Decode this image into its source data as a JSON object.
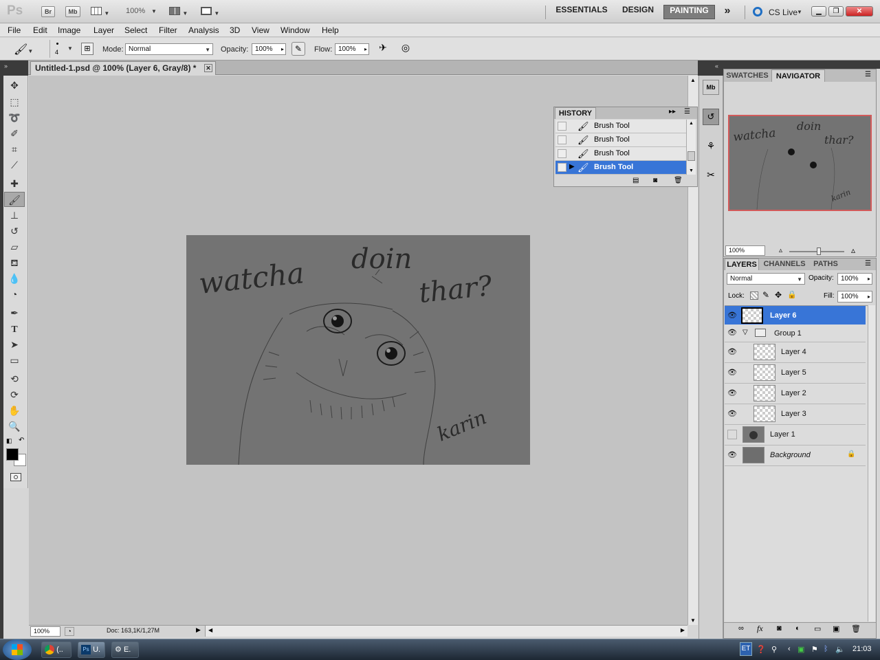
{
  "app": {
    "logo": "Ps",
    "bridge_btn": "Br",
    "mini_bridge_btn": "Mb",
    "zoom": "100%",
    "workspaces": [
      "ESSENTIALS",
      "DESIGN",
      "PAINTING"
    ],
    "active_workspace": "PAINTING",
    "more": "»",
    "cs_live": "CS Live"
  },
  "menu": [
    "File",
    "Edit",
    "Image",
    "Layer",
    "Select",
    "Filter",
    "Analysis",
    "3D",
    "View",
    "Window",
    "Help"
  ],
  "options": {
    "brush_size": "4",
    "mode_label": "Mode:",
    "mode_value": "Normal",
    "opacity_label": "Opacity:",
    "opacity_value": "100%",
    "flow_label": "Flow:",
    "flow_value": "100%"
  },
  "document": {
    "tab_title": "Untitled-1.psd @ 100% (Layer 6, Gray/8) *",
    "zoom": "100%",
    "doc_info": "Doc: 163,1K/1,27M",
    "artwork_text": {
      "line1a": "watcha",
      "line1b": "doin",
      "line2": "thar?",
      "signature": "karin"
    }
  },
  "history": {
    "title": "HISTORY",
    "items": [
      {
        "label": "Brush Tool",
        "selected": false
      },
      {
        "label": "Brush Tool",
        "selected": false
      },
      {
        "label": "Brush Tool",
        "selected": false
      },
      {
        "label": "Brush Tool",
        "selected": true
      }
    ]
  },
  "navigator": {
    "tabs": [
      "SWATCHES",
      "NAVIGATOR"
    ],
    "active": "NAVIGATOR",
    "zoom": "100%"
  },
  "layers_panel": {
    "tabs": [
      "LAYERS",
      "CHANNELS",
      "PATHS"
    ],
    "active": "LAYERS",
    "blend_mode": "Normal",
    "opacity_label": "Opacity:",
    "opacity_value": "100%",
    "lock_label": "Lock:",
    "fill_label": "Fill:",
    "fill_value": "100%",
    "layers": [
      {
        "name": "Layer 6",
        "visible": true,
        "selected": true
      },
      {
        "name": "Group 1",
        "visible": true,
        "group": true
      },
      {
        "name": "Layer 4",
        "visible": true
      },
      {
        "name": "Layer 5",
        "visible": true
      },
      {
        "name": "Layer 2",
        "visible": true
      },
      {
        "name": "Layer 3",
        "visible": true
      },
      {
        "name": "Layer 1",
        "visible": false
      },
      {
        "name": "Background",
        "visible": true,
        "locked": true
      }
    ]
  },
  "taskbar": {
    "buttons": [
      "(..",
      "U.",
      "E."
    ],
    "language": "ET",
    "time": "21:03"
  },
  "colors": {
    "selection": "#3875d7",
    "canvas_bg": "#c3c3c3",
    "artboard": "#737373"
  }
}
